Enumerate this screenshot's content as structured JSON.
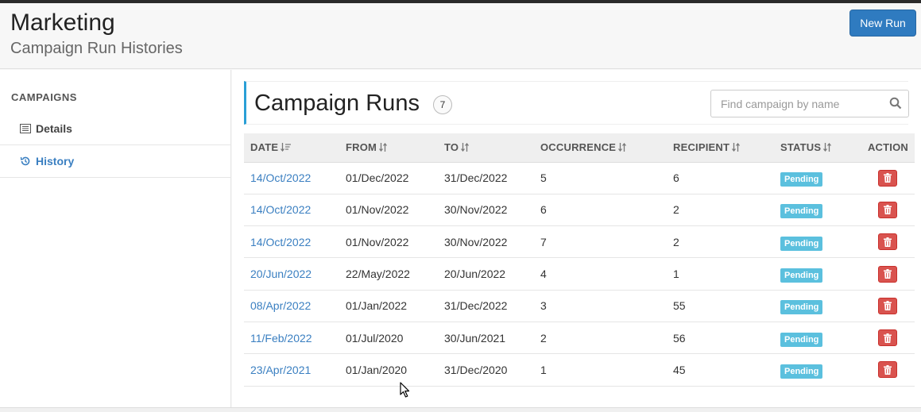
{
  "header": {
    "title": "Marketing",
    "subtitle": "Campaign Run Histories",
    "new_run_label": "New Run"
  },
  "sidebar": {
    "heading": "CAMPAIGNS",
    "items": [
      {
        "label": "Details",
        "icon": "list-icon",
        "active": false
      },
      {
        "label": "History",
        "icon": "history-icon",
        "active": true
      }
    ]
  },
  "panel": {
    "title": "Campaign Runs",
    "count": "7",
    "search_placeholder": "Find campaign by name"
  },
  "table": {
    "columns": [
      "DATE",
      "FROM",
      "TO",
      "OCCURRENCE",
      "RECIPIENT",
      "STATUS",
      "ACTION"
    ],
    "rows": [
      {
        "date": "14/Oct/2022",
        "from": "01/Dec/2022",
        "to": "31/Dec/2022",
        "occurrence": "5",
        "recipient": "6",
        "status": "Pending"
      },
      {
        "date": "14/Oct/2022",
        "from": "01/Nov/2022",
        "to": "30/Nov/2022",
        "occurrence": "6",
        "recipient": "2",
        "status": "Pending"
      },
      {
        "date": "14/Oct/2022",
        "from": "01/Nov/2022",
        "to": "30/Nov/2022",
        "occurrence": "7",
        "recipient": "2",
        "status": "Pending"
      },
      {
        "date": "20/Jun/2022",
        "from": "22/May/2022",
        "to": "20/Jun/2022",
        "occurrence": "4",
        "recipient": "1",
        "status": "Pending"
      },
      {
        "date": "08/Apr/2022",
        "from": "01/Jan/2022",
        "to": "31/Dec/2022",
        "occurrence": "3",
        "recipient": "55",
        "status": "Pending"
      },
      {
        "date": "11/Feb/2022",
        "from": "01/Jul/2020",
        "to": "30/Jun/2021",
        "occurrence": "2",
        "recipient": "56",
        "status": "Pending"
      },
      {
        "date": "23/Apr/2021",
        "from": "01/Jan/2020",
        "to": "31/Dec/2020",
        "occurrence": "1",
        "recipient": "45",
        "status": "Pending"
      }
    ]
  },
  "colors": {
    "primary": "#2f7bc0",
    "link": "#3a7fc1",
    "status_pending": "#5bc0de",
    "danger": "#d9534f",
    "panel_accent": "#2a9fd6"
  }
}
